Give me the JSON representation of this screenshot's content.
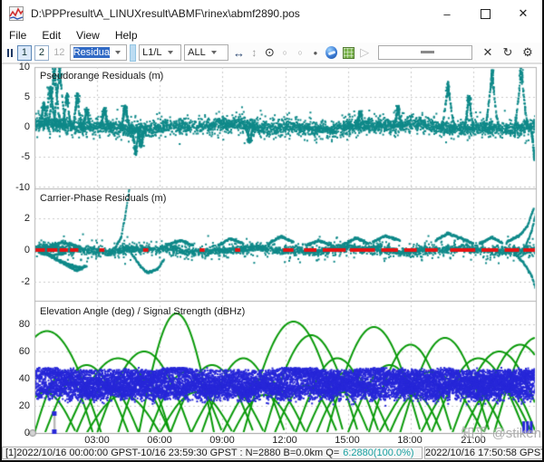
{
  "window": {
    "title": "D:\\PPPresult\\A_LINUXresult\\ABMF\\rinex\\abmf2890.pos",
    "minimize": "–",
    "close": "✕"
  },
  "menu": {
    "items": [
      "File",
      "Edit",
      "View",
      "Help"
    ]
  },
  "toolbar": {
    "view_single": "1",
    "view_double": "2",
    "view_combined": "12",
    "plot_type_value": "Residua",
    "obs_type_value": "L1/L",
    "satellite_value": "ALL",
    "icons": [
      "pause-bars",
      "fit-horizontal",
      "fit-vertical",
      "center-origin",
      "fix-horizontal",
      "fix-vertical",
      "fix-center",
      "google-earth",
      "map-view",
      "animate-play",
      "time-slider",
      "clear",
      "refresh",
      "options-gear"
    ]
  },
  "xticks": [
    "03:00",
    "06:00",
    "09:00",
    "12:00",
    "15:00",
    "18:00",
    "21:00"
  ],
  "xtick_hours": [
    3,
    6,
    9,
    12,
    15,
    18,
    21
  ],
  "colors": {
    "teal": "#0f8989",
    "red": "#e81414",
    "green": "#0a9a0a",
    "blue": "#2727d8",
    "grid": "#c9c9c9",
    "frame": "#b3b3b3",
    "selection_bg": "#316ac5",
    "quality_text": "#18a0a0"
  },
  "chart_data": [
    {
      "id": "pseudorange-residuals",
      "type": "scatter",
      "title": "Pseudorange Residuals (m)",
      "ylim": [
        -10.3,
        10.15
      ],
      "yticks": [
        "10",
        "5",
        "0",
        "-5",
        "-10"
      ],
      "ytick_values": [
        10,
        5,
        0,
        -5,
        -10
      ],
      "x_range_hours": [
        0,
        24
      ],
      "band": {
        "center": 0,
        "sigma": 0.55,
        "n_points": 2800
      },
      "spikes": [
        [
          0.45,
          3.8
        ],
        [
          0.75,
          6.5
        ],
        [
          0.95,
          9.6
        ],
        [
          1.2,
          9.9
        ],
        [
          1.55,
          5.2
        ],
        [
          2.05,
          5.4
        ],
        [
          2.5,
          2.8
        ],
        [
          3.35,
          3.0
        ],
        [
          4.35,
          3.4
        ],
        [
          4.85,
          -4.5
        ],
        [
          5.1,
          -3.2
        ],
        [
          10.3,
          -2.6
        ],
        [
          15.6,
          2.6
        ],
        [
          17.4,
          3.4
        ],
        [
          19.8,
          7.2
        ],
        [
          20.8,
          5.0
        ],
        [
          21.9,
          9.2
        ],
        [
          23.3,
          9.9
        ],
        [
          23.95,
          -5.3
        ]
      ]
    },
    {
      "id": "carrier-phase-residuals",
      "type": "scatter",
      "title": "Carrier-Phase Residuals (m)",
      "ylim": [
        -3.2,
        3.9
      ],
      "yticks": [
        "2",
        "0",
        "-2"
      ],
      "ytick_values": [
        2,
        0,
        -2
      ],
      "x_range_hours": [
        0,
        24
      ],
      "band": {
        "center": 0,
        "sigma": 0.12,
        "n_points": 2400
      },
      "strands": [
        [
          [
            0.3,
            0
          ],
          [
            0.9,
            -0.5
          ],
          [
            1.6,
            -0.9
          ],
          [
            2.3,
            -1.15
          ]
        ],
        [
          [
            0.4,
            0
          ],
          [
            1.2,
            -0.7
          ],
          [
            2.0,
            -1.3
          ],
          [
            2.5,
            -1.0
          ]
        ],
        [
          [
            0.5,
            0.1
          ],
          [
            1.3,
            0.5
          ],
          [
            2.2,
            0.2
          ]
        ],
        [
          [
            0.2,
            -0.15
          ],
          [
            0.8,
            -0.35
          ],
          [
            1.5,
            -0.2
          ]
        ],
        [
          [
            3.9,
            0.2
          ],
          [
            4.15,
            0.8
          ],
          [
            4.35,
            2.2
          ],
          [
            4.55,
            3.9
          ]
        ],
        [
          [
            4.6,
            -0.1
          ],
          [
            5.0,
            -0.9
          ],
          [
            5.4,
            -1.45
          ],
          [
            5.9,
            -1.2
          ],
          [
            6.2,
            -0.6
          ]
        ],
        [
          [
            6.3,
            0.3
          ],
          [
            7.0,
            0.6
          ],
          [
            7.6,
            0.3
          ]
        ],
        [
          [
            8.8,
            0.3
          ],
          [
            9.4,
            0.7
          ],
          [
            10.0,
            0.4
          ]
        ],
        [
          [
            11.2,
            0.4
          ],
          [
            11.8,
            0.85
          ],
          [
            12.4,
            0.5
          ]
        ],
        [
          [
            13.0,
            0.3
          ],
          [
            13.6,
            0.6
          ],
          [
            14.2,
            0.3
          ]
        ],
        [
          [
            14.8,
            0.35
          ],
          [
            15.4,
            0.75
          ],
          [
            16.0,
            0.4
          ]
        ],
        [
          [
            16.2,
            0.5
          ],
          [
            16.8,
            0.9
          ],
          [
            17.5,
            0.6
          ]
        ],
        [
          [
            19.2,
            0.6
          ],
          [
            19.8,
            1.05
          ],
          [
            20.5,
            0.7
          ],
          [
            21.0,
            0.4
          ]
        ],
        [
          [
            21.3,
            0.4
          ],
          [
            21.9,
            0.8
          ],
          [
            22.4,
            0.45
          ]
        ],
        [
          [
            22.6,
            0.5
          ],
          [
            23.2,
            0.9
          ],
          [
            23.6,
            1.5
          ],
          [
            23.9,
            2.6
          ]
        ],
        [
          [
            23.0,
            -0.2
          ],
          [
            23.4,
            -0.8
          ],
          [
            23.8,
            -1.6
          ],
          [
            24,
            -2.5
          ]
        ],
        [
          [
            23.5,
            0.2
          ],
          [
            23.8,
            1.2
          ],
          [
            24,
            2.3
          ]
        ]
      ],
      "zero_marks": [
        [
          0.05,
          0.5
        ],
        [
          0.6,
          1.1
        ],
        [
          1.2,
          1.6
        ],
        [
          1.7,
          2.1
        ],
        [
          3.1,
          3.35
        ],
        [
          5.2,
          5.45
        ],
        [
          7.9,
          8.15
        ],
        [
          9.6,
          9.85
        ],
        [
          11.9,
          12.4
        ],
        [
          12.9,
          13.5
        ],
        [
          13.8,
          14.9
        ],
        [
          15.1,
          16.3
        ],
        [
          16.6,
          17.4
        ],
        [
          17.7,
          18.3
        ],
        [
          18.7,
          19.3
        ],
        [
          19.9,
          21.1
        ],
        [
          21.4,
          22.2
        ],
        [
          22.5,
          23.2
        ],
        [
          23.4,
          24
        ]
      ]
    },
    {
      "id": "elevation-snr",
      "type": "line-scatter",
      "title": "Elevation Angle (deg) / Signal Strength (dBHz)",
      "ylim": [
        0,
        97
      ],
      "yticks": [
        "80",
        "60",
        "40",
        "20",
        "0"
      ],
      "ytick_values": [
        80,
        60,
        40,
        20,
        0
      ],
      "x_range_hours": [
        0,
        24
      ],
      "elevation_arcs": [
        [
          -2,
          3.2,
          75
        ],
        [
          0,
          2.8,
          45
        ],
        [
          0.5,
          4.5,
          50
        ],
        [
          1.5,
          6.5,
          55
        ],
        [
          2,
          5,
          35
        ],
        [
          3,
          7.5,
          60
        ],
        [
          4,
          6.5,
          40
        ],
        [
          5,
          8.6,
          88
        ],
        [
          5.5,
          9,
          45
        ],
        [
          6.5,
          10.5,
          50
        ],
        [
          7.5,
          11,
          35
        ],
        [
          8,
          12,
          55
        ],
        [
          9,
          13,
          40
        ],
        [
          10,
          14.8,
          82
        ],
        [
          11,
          15.5,
          72
        ],
        [
          11.5,
          14.5,
          35
        ],
        [
          12.5,
          16.5,
          55
        ],
        [
          13,
          17,
          45
        ],
        [
          14,
          18.5,
          78
        ],
        [
          15,
          19,
          50
        ],
        [
          16,
          20,
          65
        ],
        [
          16.5,
          21.5,
          45
        ],
        [
          17.5,
          21.8,
          70
        ],
        [
          18.5,
          22.5,
          40
        ],
        [
          19,
          23.5,
          55
        ],
        [
          20,
          24.5,
          60
        ],
        [
          21,
          25.5,
          65
        ],
        [
          20.5,
          23.8,
          35
        ],
        [
          22,
          26,
          70
        ],
        [
          -1,
          2,
          30
        ],
        [
          2.5,
          6,
          28
        ],
        [
          6,
          9.5,
          30
        ],
        [
          9.5,
          12.5,
          28
        ],
        [
          13.5,
          16,
          30
        ],
        [
          17,
          19.5,
          28
        ],
        [
          21.5,
          24,
          32
        ]
      ],
      "snr_band": {
        "min": 22,
        "max": 48,
        "typ_top": 46.5
      },
      "time_markers_hours": [
        0.95,
        23.42,
        23.6,
        23.78
      ]
    }
  ],
  "status": {
    "left": "[1]2022/10/16 00:00:00 GPST-10/16 23:59:30 GPST : N=2880 B=0.0km Q=",
    "quality": "6:2880(100.0%)",
    "right": "2022/10/16 17:50:58 GPST"
  },
  "watermark": {
    "text": "知乎 @stiken"
  }
}
